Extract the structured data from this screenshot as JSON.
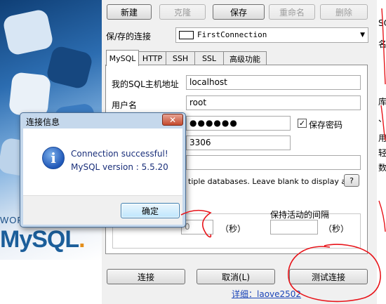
{
  "toolbar": {
    "new": "新建",
    "clone": "克隆",
    "save": "保存",
    "rename": "重命名",
    "delete": "删除"
  },
  "connection": {
    "label": "保/存的连接",
    "selected": "FirstConnection"
  },
  "tabs": [
    "MySQL",
    "HTTP",
    "SSH",
    "SSL",
    "高级功能"
  ],
  "form": {
    "host_label": "我的SQL主机地址",
    "host_value": "localhost",
    "user_label": "用户名",
    "user_value": "root",
    "password_value": "●●●●●●",
    "save_password_label": "保存密码",
    "save_password_checked": "✓",
    "port_value": "3306",
    "database_hint": "tiple databases. Leave blank to display all)",
    "help_button": "?",
    "timeout_value": "0",
    "seconds_unit": "（秒）",
    "keepalive_label": "保持活动的间隔",
    "keepalive_value": "",
    "keepalive_unit": "（秒）"
  },
  "bottom": {
    "connect": "连接",
    "cancel": "取消(L)",
    "test": "测试连接",
    "link_text": "详细：laove2502"
  },
  "background_window": {
    "fragments": [
      "SQ",
      "名",
      "库",
      "、",
      "用",
      "轻",
      "数"
    ]
  },
  "logo": {
    "world": "WOR",
    "mysql_main": "MySQL",
    "mysql_dot": "."
  },
  "dialog": {
    "title": "连接信息",
    "close": "✕",
    "message_line1": "Connection successful!",
    "message_line2": "MySQL version : 5.5.20",
    "ok": "确定"
  },
  "colors": {
    "annotation_red": "#e8141a",
    "dialog_frame": "#c5d8ec"
  }
}
